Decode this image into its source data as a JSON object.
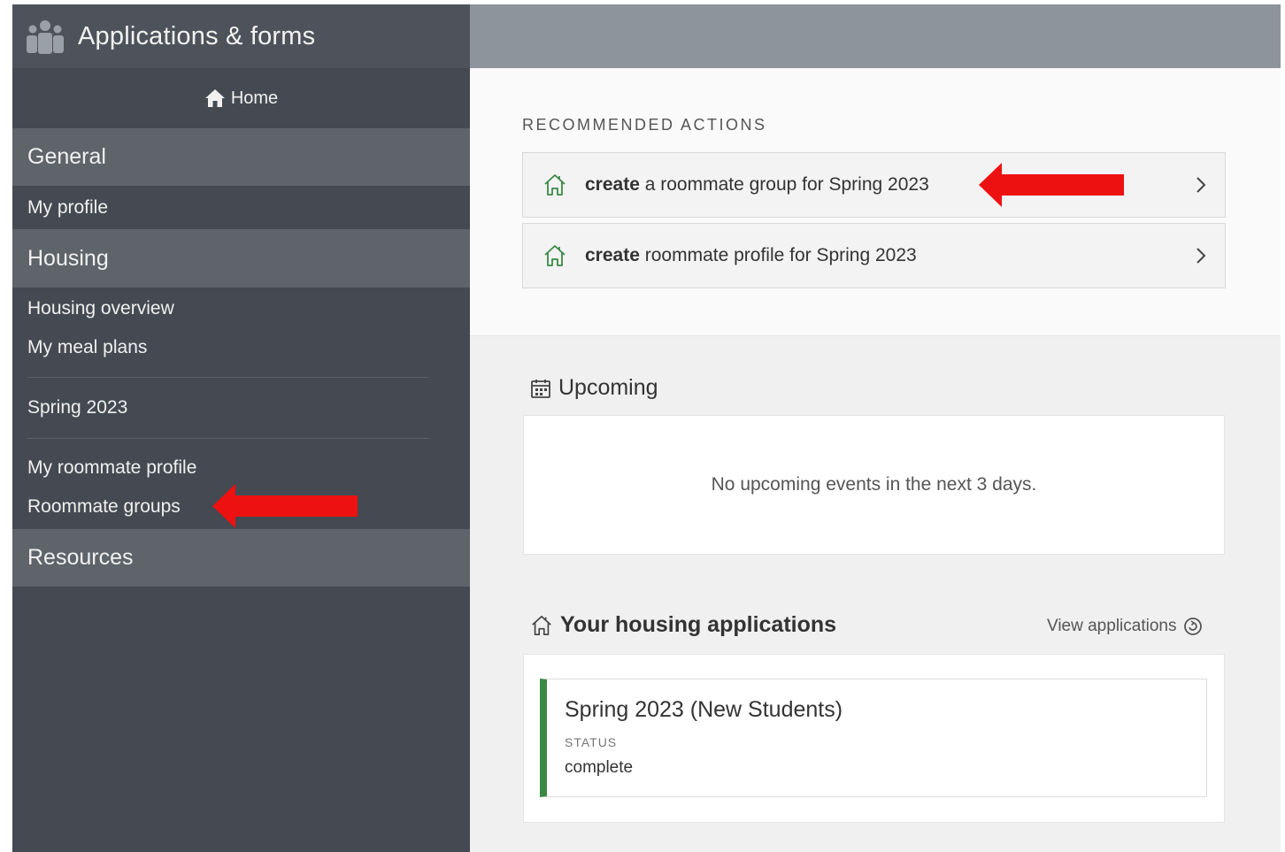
{
  "sidebar": {
    "title": "Applications & forms",
    "home_label": "Home",
    "sections": {
      "general": "General",
      "housing": "Housing",
      "resources": "Resources"
    },
    "items": {
      "my_profile": "My profile",
      "housing_overview": "Housing overview",
      "my_meal_plans": "My meal plans",
      "spring_2023": "Spring 2023",
      "my_roommate_profile": "My roommate profile",
      "roommate_groups": "Roommate groups"
    }
  },
  "recommended": {
    "heading": "RECOMMENDED ACTIONS",
    "actions": [
      {
        "verb": "create",
        "rest": " a roommate group for Spring 2023"
      },
      {
        "verb": "create",
        "rest": " roommate profile for Spring 2023"
      }
    ]
  },
  "upcoming": {
    "heading": "Upcoming",
    "empty_message": "No upcoming events in the next 3 days."
  },
  "housing_applications": {
    "heading": "Your housing applications",
    "view_link": "View applications",
    "application": {
      "title": "Spring 2023 (New Students)",
      "status_label": "STATUS",
      "status_value": "complete"
    }
  },
  "colors": {
    "sidebar_bg": "#454a52",
    "sidebar_section_bg": "#5f646b",
    "topbar_bg": "#8d949c",
    "accent_green": "#3a8a45",
    "annotation_red": "#ee1111"
  },
  "icons": {
    "sidebar_title": "people-group-icon",
    "home": "home-icon",
    "action": "house-outline-icon",
    "upcoming": "calendar-icon",
    "applications": "house-outline-icon",
    "view_link": "arrow-circle-icon",
    "chevron": "chevron-right-icon"
  }
}
